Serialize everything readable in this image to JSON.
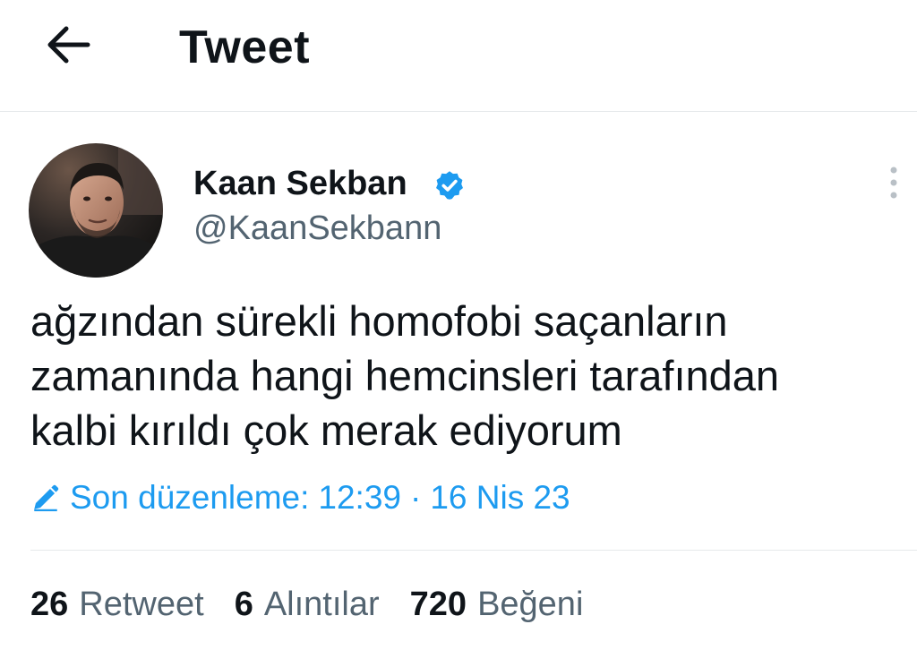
{
  "header": {
    "title": "Tweet",
    "back_icon": "arrow-left-icon"
  },
  "author": {
    "name": "Kaan Sekban",
    "handle": "@KaanSekbann",
    "verified": true,
    "verified_icon": "verified-badge-icon",
    "avatar": "profile-photo",
    "more_icon": "more-vertical-icon"
  },
  "tweet": {
    "lines": [
      "ağzından sürekli homofobi saçanların",
      "zamanında hangi hemcinsleri tarafından",
      "kalbi kırıldı çok merak ediyorum"
    ]
  },
  "edit_info": {
    "icon": "pencil-icon",
    "label": "Son düzenleme:",
    "time": "12:39",
    "separator": "·",
    "date": "16 Nis 23"
  },
  "stats": {
    "retweets": {
      "count": "26",
      "label": "Retweet"
    },
    "quotes": {
      "count": "6",
      "label": "Alıntılar"
    },
    "likes": {
      "count": "720",
      "label": "Beğeni"
    }
  },
  "colors": {
    "accent": "#1d9bf0",
    "text_primary": "#0f1419",
    "text_secondary": "#536471",
    "divider": "#e6e9eb"
  }
}
